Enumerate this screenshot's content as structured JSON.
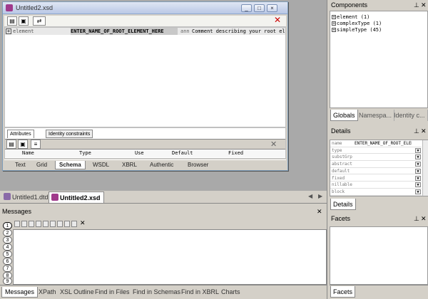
{
  "document_window": {
    "title": "Untitled2.xsd",
    "root_row": {
      "kind": "element",
      "name": "ENTER_NAME_OF_ROOT_ELEMENT_HERE",
      "ann": "ann",
      "comment": "Comment describing your root element"
    },
    "attr_panel": {
      "tabs": [
        "Attributes",
        "Identity constraints"
      ],
      "columns": [
        "Name",
        "Type",
        "Use",
        "Default",
        "Fixed"
      ]
    },
    "view_tabs": [
      "Text",
      "Grid",
      "Schema",
      "WSDL",
      "XBRL",
      "Authentic",
      "Browser"
    ],
    "active_view": "Schema"
  },
  "doc_tabs": [
    {
      "label": "Untitled1.dtd",
      "active": false
    },
    {
      "label": "Untitled2.xsd",
      "active": true
    }
  ],
  "messages": {
    "title": "Messages",
    "side_tabs": [
      "1",
      "2",
      "3",
      "4",
      "5",
      "6",
      "7",
      "8",
      "9"
    ]
  },
  "bottom_tabs": [
    "Messages",
    "XPath",
    "XSL Outline",
    "Find in Files",
    "Find in Schemas",
    "Find in XBRL",
    "Charts"
  ],
  "components": {
    "title": "Components",
    "items": [
      "element (1)",
      "complexType (1)",
      "simpleType (45)"
    ],
    "tabs": [
      "Globals",
      "Namespa...",
      "Identity c..."
    ]
  },
  "details": {
    "title": "Details",
    "rows": [
      {
        "name": "name",
        "value": "ENTER_NAME_OF_ROOT_ELEMENT"
      },
      {
        "name": "type",
        "value": ""
      },
      {
        "name": "substGrp",
        "value": ""
      },
      {
        "name": "abstract",
        "value": ""
      },
      {
        "name": "default",
        "value": ""
      },
      {
        "name": "fixed",
        "value": ""
      },
      {
        "name": "nillable",
        "value": ""
      },
      {
        "name": "block",
        "value": ""
      }
    ],
    "tab": "Details"
  },
  "facets": {
    "title": "Facets",
    "tab": "Facets"
  },
  "colors": {
    "accent": "#a03a8c",
    "chrome": "#d4d0c8",
    "mdi_background": "#a9a9a9"
  }
}
